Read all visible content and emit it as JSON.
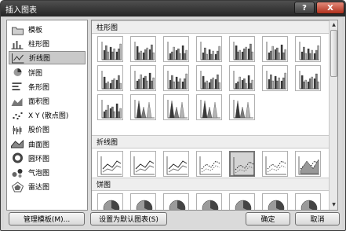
{
  "window": {
    "title": "插入图表",
    "help_label": "?",
    "close_label": "X"
  },
  "categories": [
    {
      "label": "模板",
      "icon": "folder-icon",
      "selected": false
    },
    {
      "label": "柱形图",
      "icon": "column-chart-icon",
      "selected": false
    },
    {
      "label": "折线图",
      "icon": "line-chart-icon",
      "selected": true
    },
    {
      "label": "饼图",
      "icon": "pie-chart-icon",
      "selected": false
    },
    {
      "label": "条形图",
      "icon": "bar-chart-icon",
      "selected": false
    },
    {
      "label": "面积图",
      "icon": "area-chart-icon",
      "selected": false
    },
    {
      "label": "X Y (散点图)",
      "icon": "scatter-chart-icon",
      "selected": false
    },
    {
      "label": "股价图",
      "icon": "stock-chart-icon",
      "selected": false
    },
    {
      "label": "曲面图",
      "icon": "surface-chart-icon",
      "selected": false
    },
    {
      "label": "圆环图",
      "icon": "doughnut-chart-icon",
      "selected": false
    },
    {
      "label": "气泡图",
      "icon": "bubble-chart-icon",
      "selected": false
    },
    {
      "label": "雷达图",
      "icon": "radar-chart-icon",
      "selected": false
    }
  ],
  "sections": [
    {
      "title": "柱形图",
      "thumb_count": 19,
      "kind": "column"
    },
    {
      "title": "折线图",
      "thumb_count": 7,
      "kind": "line",
      "selected_index": 4
    },
    {
      "title": "饼图",
      "thumb_count": 7,
      "kind": "pie"
    }
  ],
  "buttons": {
    "manage_templates": "管理模板(M)...",
    "set_default": "设置为默认图表(S)",
    "ok": "确定",
    "cancel": "取消"
  }
}
